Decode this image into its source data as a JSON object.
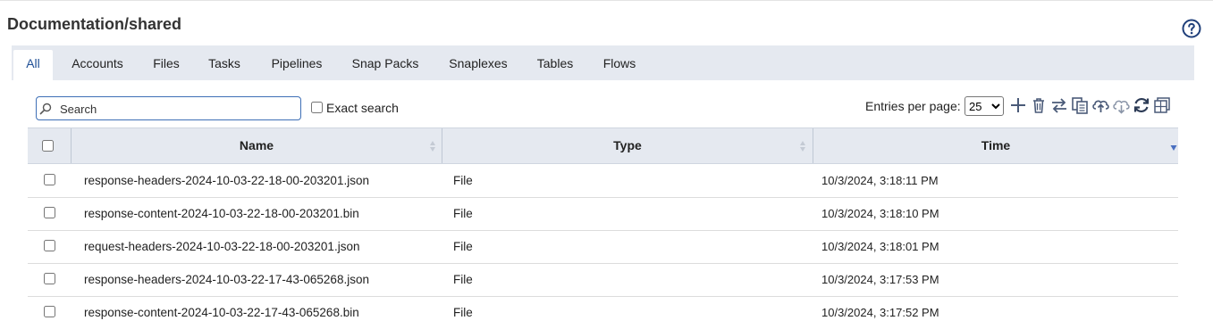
{
  "header": {
    "title": "Documentation/shared",
    "help_icon": "question-circle-icon"
  },
  "tabs": [
    {
      "label": "All",
      "active": true
    },
    {
      "label": "Accounts"
    },
    {
      "label": "Files"
    },
    {
      "label": "Tasks"
    },
    {
      "label": "Pipelines"
    },
    {
      "label": "Snap Packs"
    },
    {
      "label": "Snaplexes"
    },
    {
      "label": "Tables"
    },
    {
      "label": "Flows"
    }
  ],
  "toolbar": {
    "search_placeholder": "Search",
    "search_value": "",
    "exact_search_label": "Exact search",
    "entries_label": "Entries per page:",
    "entries_value": "25",
    "tools": [
      "plus-icon",
      "trash-icon",
      "swap-icon",
      "copy-icon",
      "upload-icon",
      "download-icon",
      "refresh-icon",
      "grid-icon"
    ]
  },
  "table": {
    "columns": [
      "Name",
      "Type",
      "Time"
    ],
    "rows": [
      {
        "name": "response-headers-2024-10-03-22-18-00-203201.json",
        "type": "File",
        "time": "10/3/2024, 3:18:11 PM"
      },
      {
        "name": "response-content-2024-10-03-22-18-00-203201.bin",
        "type": "File",
        "time": "10/3/2024, 3:18:10 PM"
      },
      {
        "name": "request-headers-2024-10-03-22-18-00-203201.json",
        "type": "File",
        "time": "10/3/2024, 3:18:01 PM"
      },
      {
        "name": "response-headers-2024-10-03-22-17-43-065268.json",
        "type": "File",
        "time": "10/3/2024, 3:17:53 PM"
      },
      {
        "name": "response-content-2024-10-03-22-17-43-065268.bin",
        "type": "File",
        "time": "10/3/2024, 3:17:52 PM"
      }
    ]
  },
  "colors": {
    "accent": "#1f4f96",
    "header_bg": "#e5e9f0",
    "icon": "#4a5a78"
  }
}
